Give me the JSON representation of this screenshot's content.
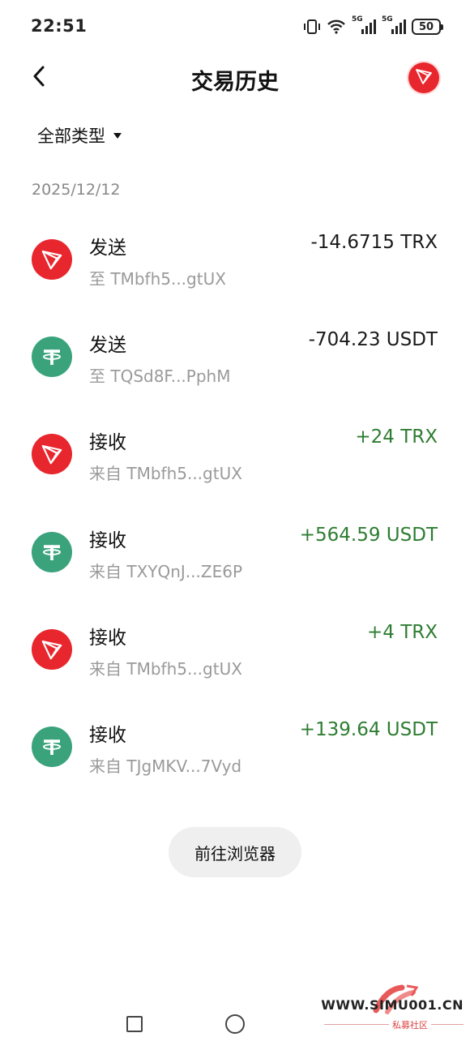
{
  "status": {
    "time": "22:51",
    "battery": "50",
    "signal_1_label": "5G",
    "signal_2_label": "5G"
  },
  "header": {
    "title": "交易历史"
  },
  "filter": {
    "label": "全部类型"
  },
  "date_group": "2025/12/12",
  "transactions": [
    {
      "type": "发送",
      "address": "至 TMbfh5...gtUX",
      "amount": "-14.6715 TRX",
      "token": "trx",
      "direction": "out"
    },
    {
      "type": "发送",
      "address": "至 TQSd8F...PphM",
      "amount": "-704.23 USDT",
      "token": "usdt",
      "direction": "out"
    },
    {
      "type": "接收",
      "address": "来自 TMbfh5...gtUX",
      "amount": "+24 TRX",
      "token": "trx",
      "direction": "in"
    },
    {
      "type": "接收",
      "address": "来自 TXYQnJ...ZE6P",
      "amount": "+564.59 USDT",
      "token": "usdt",
      "direction": "in"
    },
    {
      "type": "接收",
      "address": "来自 TMbfh5...gtUX",
      "amount": "+4 TRX",
      "token": "trx",
      "direction": "in"
    },
    {
      "type": "接收",
      "address": "来自 TJgMKV...7Vyd",
      "amount": "+139.64 USDT",
      "token": "usdt",
      "direction": "in"
    }
  ],
  "explorer_button": "前往浏览器",
  "watermark": {
    "text": "WWW.SIMU001.CN",
    "sub": "私募社区"
  },
  "colors": {
    "trx_red": "#e8262d",
    "usdt_green": "#3aa37c",
    "positive_amount": "#2e7d32"
  },
  "icons": {
    "back": "chevron-left-icon",
    "trx": "tron-logo-icon",
    "usdt": "tether-logo-icon"
  }
}
